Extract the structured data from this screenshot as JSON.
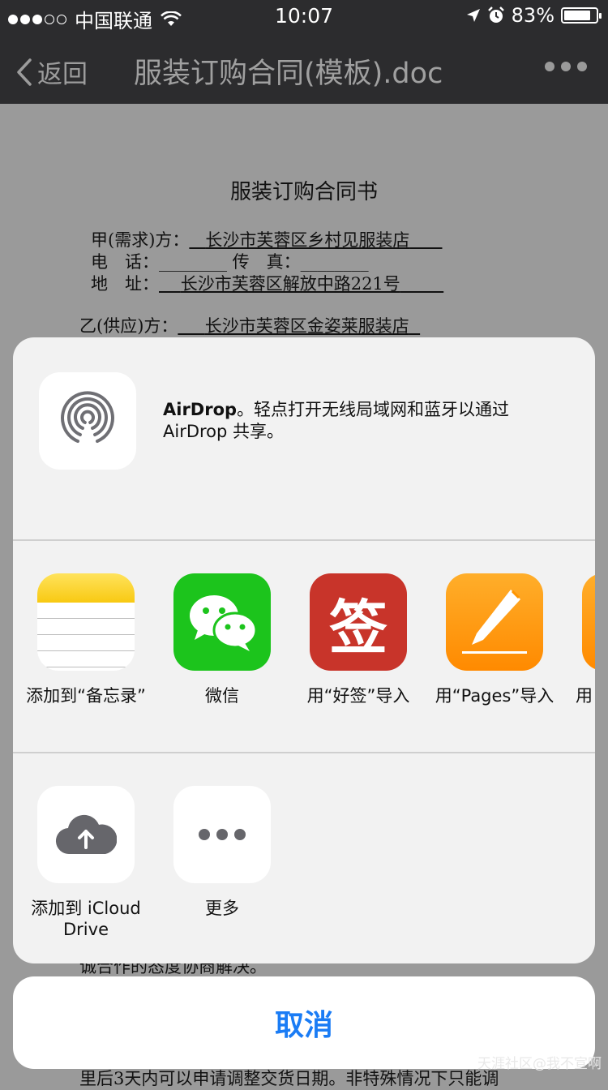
{
  "status_bar": {
    "carrier": "中国联通",
    "time": "10:07",
    "battery": "83%",
    "battery_level": 0.83,
    "signal_filled": 3,
    "signal_total": 5
  },
  "nav": {
    "back_label": "返回",
    "title": "服装订购合同(模板).doc"
  },
  "document": {
    "title": "服装订购合同书",
    "lines": [
      {
        "label": "甲(需求)方：",
        "value": "长沙市芙蓉区乡村见服装店"
      },
      {
        "label": "电　话：",
        "value": "________  传　真：________"
      },
      {
        "label": "地　址：",
        "value": "长沙市芙蓉区解放中路221号"
      },
      {
        "label": "乙(供应)方：",
        "value": "长沙市芙蓉区金姿莱服装店"
      }
    ],
    "bottom_line1": "诚合作的态度协商解决。",
    "bottom_line2": "里后3天内可以申请调整交货日期。非特殊情况下只能调"
  },
  "share_sheet": {
    "airdrop": {
      "title": "AirDrop",
      "description": "。轻点打开无线局域网和蓝牙以通过 AirDrop 共享。"
    },
    "apps": [
      {
        "label": "添加到“备忘录”",
        "icon": "notes-icon"
      },
      {
        "label": "微信",
        "icon": "wechat-icon"
      },
      {
        "label": "用“好签”导入",
        "icon": "haoqian-icon",
        "glyph": "签"
      },
      {
        "label": "用“Pages”导入",
        "icon": "pages-icon"
      },
      {
        "label": "用",
        "icon": "app-partial-icon"
      }
    ],
    "actions": [
      {
        "label": "添加到 iCloud Drive",
        "icon": "icloud-upload-icon"
      },
      {
        "label": "更多",
        "icon": "more-icon"
      }
    ],
    "cancel_label": "取消"
  },
  "watermark": "天涯社区@我不宣啊",
  "colors": {
    "accent": "#1a7cf5",
    "wechat": "#1cc41c",
    "haoqian": "#c8342a",
    "pages": "#ff9500"
  }
}
